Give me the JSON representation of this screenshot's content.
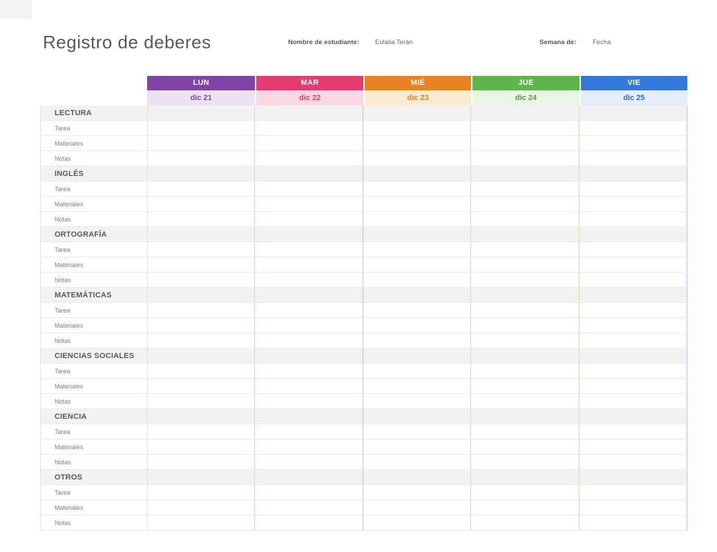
{
  "page": {
    "title": "Registro de deberes"
  },
  "fields": {
    "student_label": "Nombre de estudiante:",
    "student_value": "Eulalia Terán",
    "week_label": "Semana de:",
    "week_value": "Fecha"
  },
  "colors": {
    "title_text": "#595959",
    "subject_row_bg": "#f2f2f2",
    "gridline": "#e9e9e9",
    "label_col_border": "#e3e3e3"
  },
  "table": {
    "days": [
      {
        "name": "LUN",
        "date": "dic 21",
        "header_bg": "#8143a8",
        "date_bg": "#ebe3f3",
        "date_color": "#8143a8",
        "line": "#dfcbea",
        "left_line": "#e6daf0"
      },
      {
        "name": "MAR",
        "date": "dic 22",
        "header_bg": "#e73a6e",
        "date_bg": "#fad8e3",
        "date_color": "#e73a6e",
        "line": "#f3acc5",
        "left_line": ""
      },
      {
        "name": "MIÉ",
        "date": "dic 23",
        "header_bg": "#ea8221",
        "date_bg": "#fcebd3",
        "date_color": "#e8820c",
        "line": "#f6ce9c",
        "left_line": ""
      },
      {
        "name": "JUE",
        "date": "dic 24",
        "header_bg": "#5fb54b",
        "date_bg": "#eaf5e5",
        "date_color": "#4ca534",
        "line": "#c2e1b7",
        "left_line": ""
      },
      {
        "name": "VIE",
        "date": "dic 25",
        "header_bg": "#3378dc",
        "date_bg": "#e4edf9",
        "date_color": "#2a6cce",
        "line": "#afcbf0",
        "left_line": ""
      }
    ],
    "subjects": [
      "LECTURA",
      "INGLÉS",
      "ORTOGRAFÍA",
      "MATEMÁTICAS",
      "CIENCIAS SOCIALES",
      "CIENCIA",
      "OTROS"
    ],
    "sub_rows": [
      "Tarea",
      "Materiales",
      "Notas"
    ]
  }
}
